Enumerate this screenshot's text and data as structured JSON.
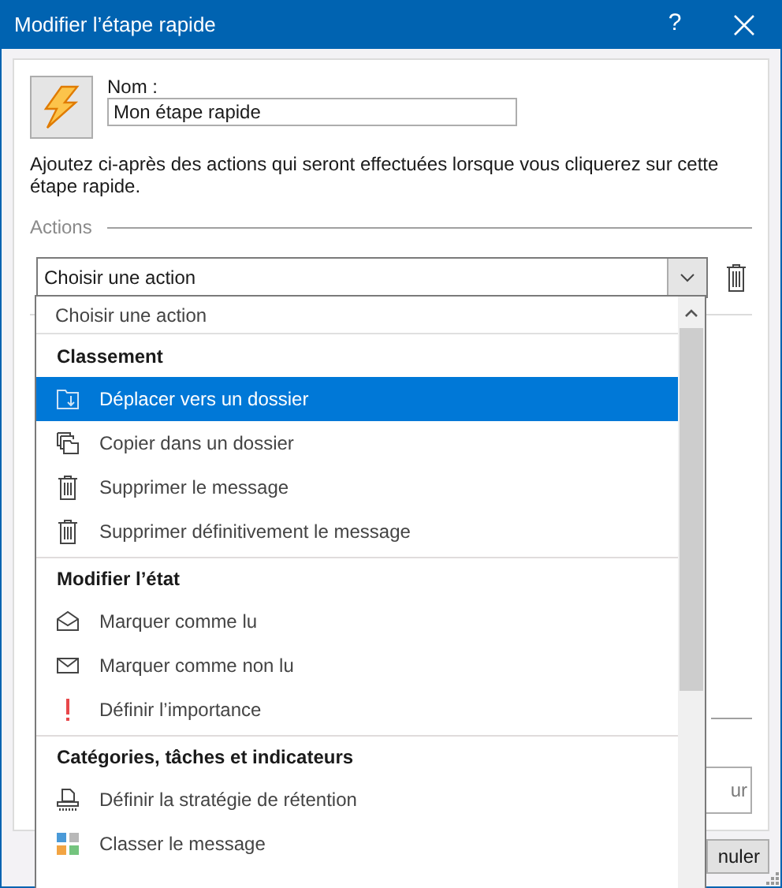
{
  "window": {
    "title": "Modifier l’étape rapide",
    "help": "?"
  },
  "name_field": {
    "label": "Nom :",
    "value": "Mon étape rapide"
  },
  "description": "Ajoutez ci-après des actions qui seront effectuées lorsque vous cliquerez sur cette étape rapide.",
  "actions_group": {
    "legend": "Actions"
  },
  "action_select": {
    "value": "Choisir une action",
    "expanded": true
  },
  "dropdown": {
    "items": [
      {
        "kind": "option",
        "label": "Choisir une action"
      },
      {
        "kind": "header",
        "label": "Classement"
      },
      {
        "kind": "action",
        "label": "Déplacer vers un dossier",
        "selected": true
      },
      {
        "kind": "action",
        "label": "Copier dans un dossier",
        "selected": false
      },
      {
        "kind": "action",
        "label": "Supprimer le message",
        "selected": false
      },
      {
        "kind": "action",
        "label": "Supprimer définitivement le message",
        "selected": false
      },
      {
        "kind": "header",
        "label": "Modifier l’état"
      },
      {
        "kind": "action",
        "label": "Marquer comme lu",
        "selected": false
      },
      {
        "kind": "action",
        "label": "Marquer comme non lu",
        "selected": false
      },
      {
        "kind": "action",
        "label": "Définir l’importance",
        "selected": false
      },
      {
        "kind": "header",
        "label": "Catégories, tâches et indicateurs"
      },
      {
        "kind": "action",
        "label": "Définir la stratégie de rétention",
        "selected": false
      },
      {
        "kind": "action",
        "label": "Classer le message",
        "selected": false
      }
    ]
  },
  "buttons": [
    {
      "label": "ur"
    },
    {
      "label": "nuler"
    }
  ]
}
